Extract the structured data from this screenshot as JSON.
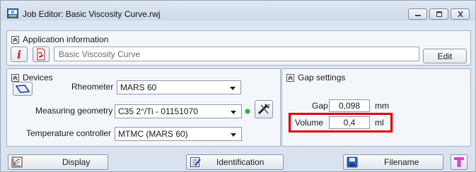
{
  "window": {
    "title": "Job Editor: Basic Viscosity Curve.rwj",
    "controls": [
      "minimize",
      "maximize",
      "close"
    ]
  },
  "application_info": {
    "header": "Application information",
    "name_value": "Basic Viscosity Curve",
    "edit_label": "Edit",
    "info_icon": "info-icon",
    "pdf_icon": "pdf-icon"
  },
  "devices": {
    "header": "Devices",
    "rheometer_label": "Rheometer",
    "rheometer_value": "MARS 60",
    "geometry_label": "Measuring geometry",
    "geometry_value": "C35 2°/Ti - 01151070",
    "temperature_label": "Temperature controller",
    "temperature_value": "MTMC (MARS 60)",
    "status_color": "#2fae2f"
  },
  "gap_settings": {
    "header": "Gap settings",
    "gap_label": "Gap",
    "gap_value": "0,098",
    "gap_unit": "mm",
    "volume_label": "Volume",
    "volume_value": "0,4",
    "volume_unit": "ml",
    "highlight_color": "#e00000"
  },
  "toolbar": {
    "display_label": "Display",
    "identification_label": "Identification",
    "filename_label": "Filename"
  }
}
